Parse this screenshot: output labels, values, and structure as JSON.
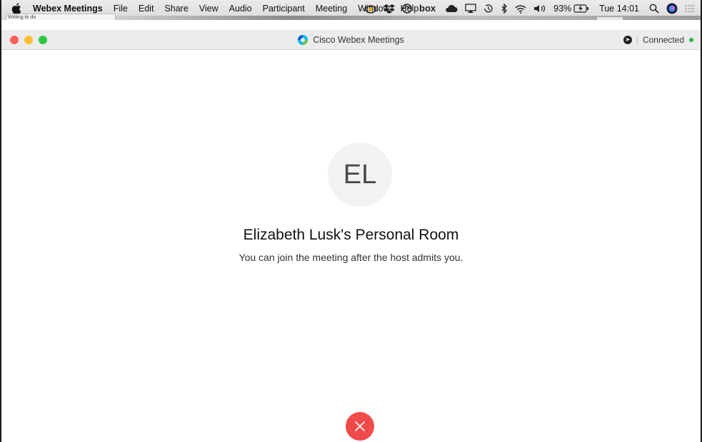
{
  "menubar": {
    "app_name": "Webex Meetings",
    "items": [
      "File",
      "Edit",
      "Share",
      "View",
      "Audio",
      "Participant",
      "Meeting",
      "Window",
      "Help"
    ],
    "battery": "93%",
    "clock": "Tue 14:01",
    "tray_icons": [
      "creative-cloud-icon",
      "dropbox-icon",
      "sync-icon",
      "box-icon",
      "cloud-icon",
      "airplay-icon",
      "time-machine-icon",
      "bluetooth-icon",
      "wifi-icon",
      "volume-icon",
      "battery-icon",
      "search-icon",
      "siri-icon",
      "notification-center-icon"
    ]
  },
  "tab_strip": {
    "label": "Writing to do"
  },
  "window": {
    "title": "Cisco Webex Meetings",
    "status": "Connected",
    "status_color": "#2bb24c"
  },
  "room": {
    "initials": "EL",
    "title": "Elizabeth Lusk's Personal Room",
    "message": "You can join the meeting after the host admits you."
  },
  "colors": {
    "leave_button": "#f04a4a"
  }
}
